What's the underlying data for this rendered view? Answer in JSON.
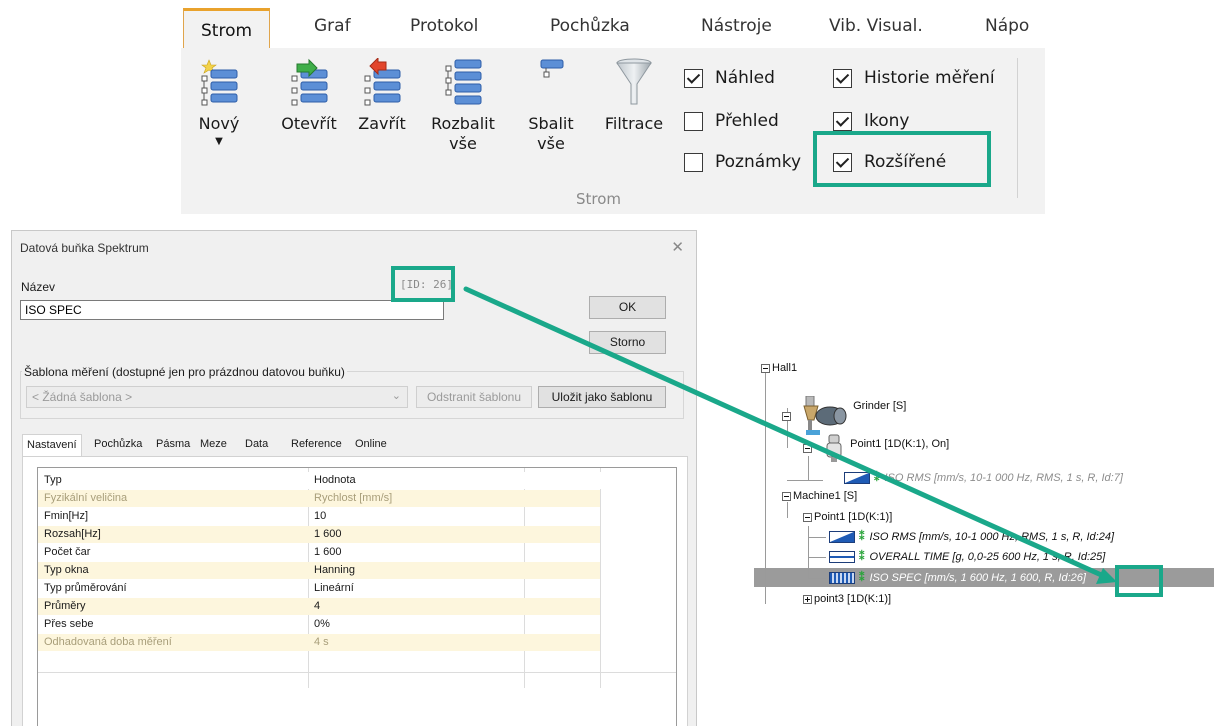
{
  "ribbon": {
    "tabs": [
      "Strom",
      "Graf",
      "Protokol",
      "Pochůzka",
      "Nástroje",
      "Vib. Visual.",
      "Nápo"
    ],
    "buttons": {
      "new": "Nový",
      "open": "Otevřít",
      "close": "Zavřít",
      "expand": [
        "Rozbalit",
        "vše"
      ],
      "collapse": [
        "Sbalit",
        "vše"
      ],
      "filter": "Filtrace"
    },
    "group_label": "Strom",
    "checkboxes": {
      "nahled": {
        "label": "Náhled",
        "checked": true
      },
      "prehled": {
        "label": "Přehled",
        "checked": false
      },
      "poznamky": {
        "label": "Poznámky",
        "checked": false
      },
      "historie": {
        "label": "Historie měření",
        "checked": true
      },
      "ikony": {
        "label": "Ikony",
        "checked": true
      },
      "rozsirene": {
        "label": "Rozšířené",
        "checked": true
      }
    }
  },
  "dialog": {
    "title": "Datová buňka Spektrum",
    "close_glyph": "✕",
    "name_label": "Název",
    "id_text": "[ID: 26]",
    "name_value": "ISO SPEC",
    "ok": "OK",
    "cancel": "Storno",
    "template_legend": "Šablona měření (dostupné jen pro prázdnou datovou buňku)",
    "template_value": "< Žádná šablona >",
    "remove_template": "Odstranit šablonu",
    "save_template": "Uložit jako šablonu",
    "tabs": [
      "Nastavení",
      "Pochůzka",
      "Pásma",
      "Meze",
      "Data",
      "Reference",
      "Online"
    ],
    "grid": {
      "headers": [
        "Typ",
        "Hodnota"
      ],
      "rows": [
        {
          "name": "Fyzikální veličina",
          "value": "Rychlost [mm/s]"
        },
        {
          "name": "Fmin[Hz]",
          "value": "10"
        },
        {
          "name": "Rozsah[Hz]",
          "value": "1 600"
        },
        {
          "name": "Počet čar",
          "value": "1 600"
        },
        {
          "name": "Typ okna",
          "value": "Hanning"
        },
        {
          "name": "Typ průměrování",
          "value": "Lineární"
        },
        {
          "name": "Průměry",
          "value": "4"
        },
        {
          "name": "Přes sebe",
          "value": "0%"
        },
        {
          "name": "Odhadovaná doba měření",
          "value": "4 s"
        }
      ]
    }
  },
  "tree": {
    "hall": "Hall1",
    "grinder": "Grinder [S]",
    "point1_on": "Point1 [1D(K:1), On]",
    "iso_rms_7": "ISO RMS [mm/s, 10-1 000 Hz, RMS, 1 s, R, Id:7]",
    "machine1": "Machine1 [S]",
    "point1": "Point1 [1D(K:1)]",
    "iso_rms_24": "ISO RMS [mm/s, 10-1 000 Hz, RMS, 1 s, R, Id:24]",
    "overall_time": "OVERALL TIME [g, 0,0-25 600 Hz, 1 s, R, Id:25]",
    "iso_spec": "ISO SPEC [mm/s, 1 600 Hz, 1 600, R, Id:26]",
    "point3": "point3 [1D(K:1)]",
    "footprint_glyph": "⁑"
  },
  "colors": {
    "highlight": "#1aa88a",
    "active_tab_accent": "#e9a22c",
    "alt_row": "#fdf6dd",
    "tree_icon_blue": "#1f5bb5"
  }
}
